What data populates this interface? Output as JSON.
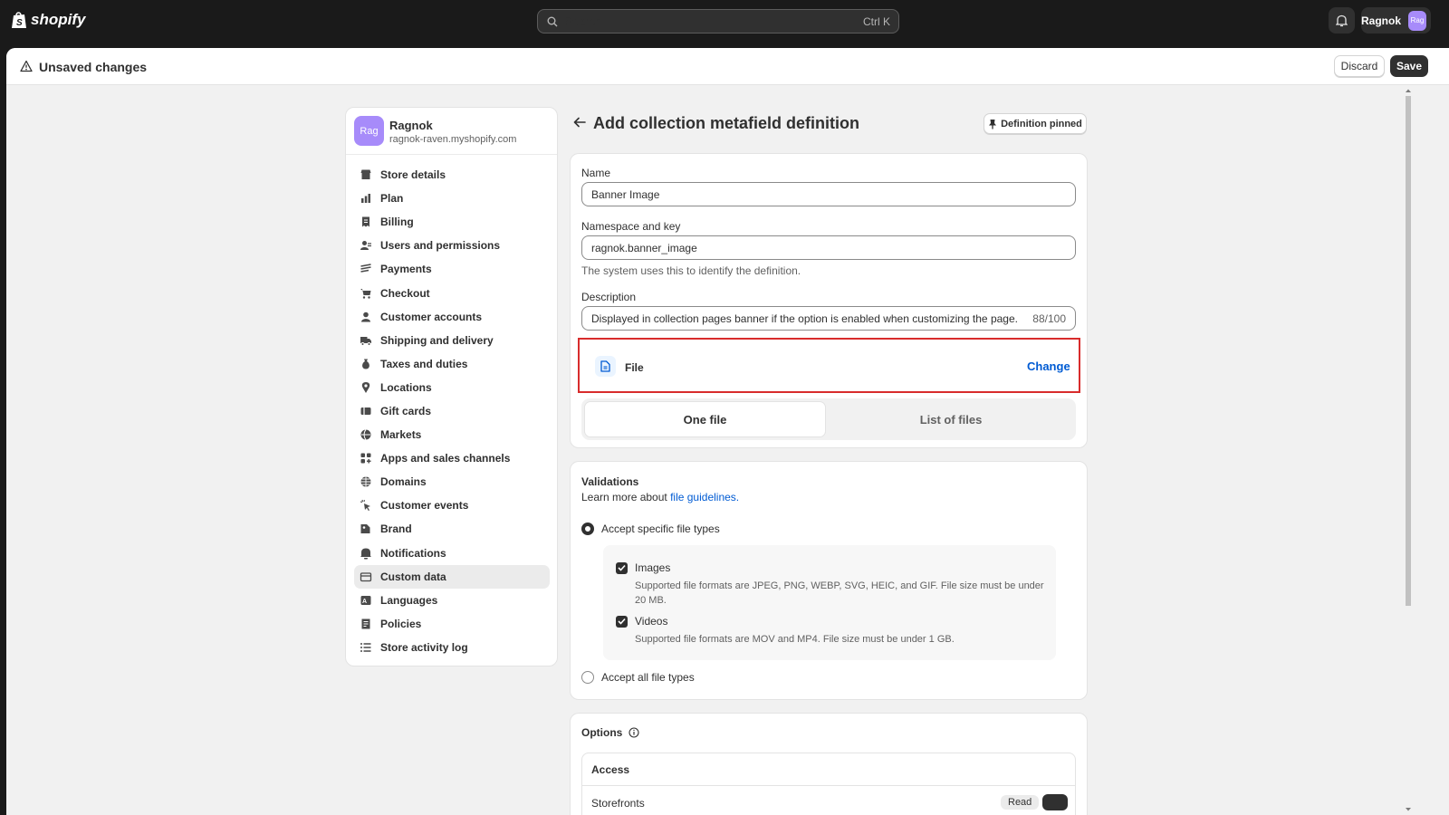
{
  "topbar": {
    "brand": "shopify",
    "search_placeholder": "Search",
    "search_shortcut": "Ctrl K",
    "user_name": "Ragnok",
    "user_initials": "Rag"
  },
  "savebar": {
    "title": "Unsaved changes",
    "discard_label": "Discard",
    "save_label": "Save"
  },
  "store": {
    "initials": "Rag",
    "name": "Ragnok",
    "url": "ragnok-raven.myshopify.com"
  },
  "nav": {
    "items": [
      {
        "label": "Store details",
        "icon": "store-icon"
      },
      {
        "label": "Plan",
        "icon": "plan-icon"
      },
      {
        "label": "Billing",
        "icon": "billing-icon"
      },
      {
        "label": "Users and permissions",
        "icon": "users-icon"
      },
      {
        "label": "Payments",
        "icon": "payments-icon"
      },
      {
        "label": "Checkout",
        "icon": "cart-icon"
      },
      {
        "label": "Customer accounts",
        "icon": "person-icon"
      },
      {
        "label": "Shipping and delivery",
        "icon": "truck-icon"
      },
      {
        "label": "Taxes and duties",
        "icon": "tax-icon"
      },
      {
        "label": "Locations",
        "icon": "location-icon"
      },
      {
        "label": "Gift cards",
        "icon": "gift-card-icon"
      },
      {
        "label": "Markets",
        "icon": "globe-icon"
      },
      {
        "label": "Apps and sales channels",
        "icon": "apps-icon"
      },
      {
        "label": "Domains",
        "icon": "domain-icon"
      },
      {
        "label": "Customer events",
        "icon": "events-icon"
      },
      {
        "label": "Brand",
        "icon": "brand-icon"
      },
      {
        "label": "Notifications",
        "icon": "bell-icon"
      },
      {
        "label": "Custom data",
        "icon": "custom-data-icon"
      },
      {
        "label": "Languages",
        "icon": "language-icon"
      },
      {
        "label": "Policies",
        "icon": "policy-icon"
      },
      {
        "label": "Store activity log",
        "icon": "list-icon"
      }
    ],
    "active_label": "Custom data"
  },
  "page": {
    "title": "Add collection metafield definition",
    "pinned_label": "Definition pinned"
  },
  "form": {
    "name_label": "Name",
    "name_value": "Banner Image",
    "key_label": "Namespace and key",
    "key_value": "ragnok.banner_image",
    "key_help": "The system uses this to identify the definition.",
    "desc_label": "Description",
    "desc_value": "Displayed in collection pages banner if the option is enabled when customizing the page.",
    "desc_count": "88/100",
    "type_name": "File",
    "type_change": "Change",
    "seg_one": "One file",
    "seg_list": "List of files"
  },
  "validations": {
    "title": "Validations",
    "learn_prefix": "Learn more about",
    "learn_link": "file guidelines.",
    "opt_specific": "Accept specific file types",
    "images_label": "Images",
    "images_help": "Supported file formats are JPEG, PNG, WEBP, SVG, HEIC, and GIF. File size must be under 20 MB.",
    "videos_label": "Videos",
    "videos_help": "Supported file formats are MOV and MP4. File size must be under 1 GB.",
    "opt_all": "Accept all file types"
  },
  "options": {
    "title": "Options",
    "access_label": "Access",
    "row_label": "Storefronts",
    "row_badge": "Read"
  },
  "colors": {
    "link": "#005bd3",
    "highlight": "#d82c2c",
    "avatar": "#a78bfa"
  }
}
